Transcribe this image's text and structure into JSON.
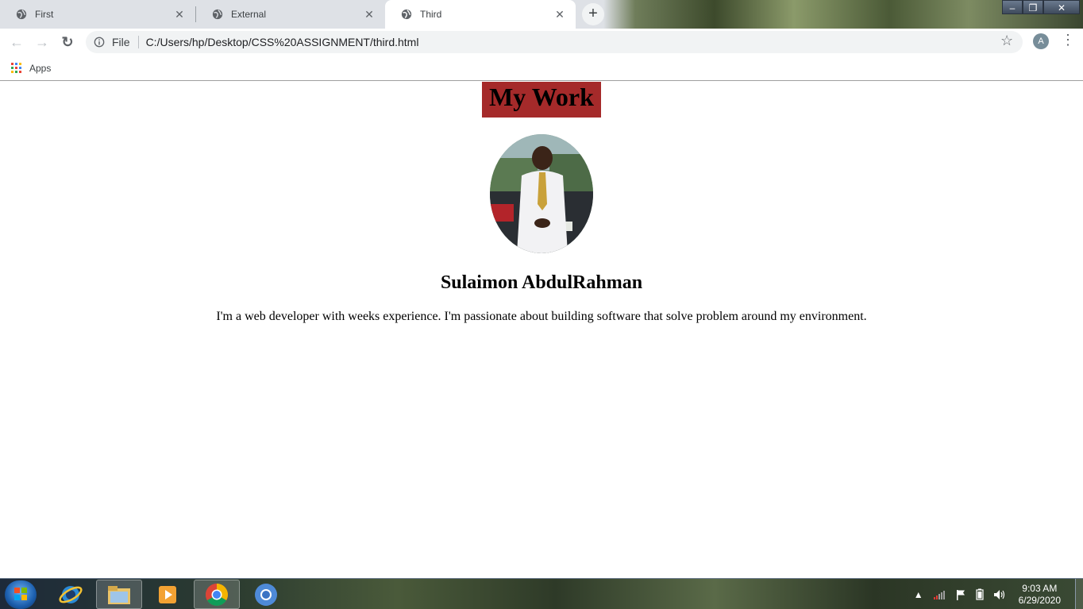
{
  "browser": {
    "tabs": [
      {
        "label": "First",
        "active": false
      },
      {
        "label": "External",
        "active": false
      },
      {
        "label": "Third",
        "active": true
      }
    ],
    "new_tab_label": "+",
    "window_controls": {
      "minimize": "–",
      "restore": "❐",
      "close": "✕"
    },
    "toolbar": {
      "back": "←",
      "forward": "→",
      "reload": "↻",
      "file_label": "File",
      "url": "C:/Users/hp/Desktop/CSS%20ASSIGNMENT/third.html",
      "star": "☆",
      "avatar_initial": "A",
      "menu": "⋮"
    },
    "bookmarks": {
      "apps_label": "Apps"
    }
  },
  "page": {
    "heading": "My Work",
    "heading_bg": "#a52a2a",
    "name": "Sulaimon AbdulRahman",
    "bio": "I'm a web developer with weeks experience. I'm passionate about building software that solve problem around my environment."
  },
  "taskbar": {
    "time": "9:03 AM",
    "date": "6/29/2020"
  }
}
